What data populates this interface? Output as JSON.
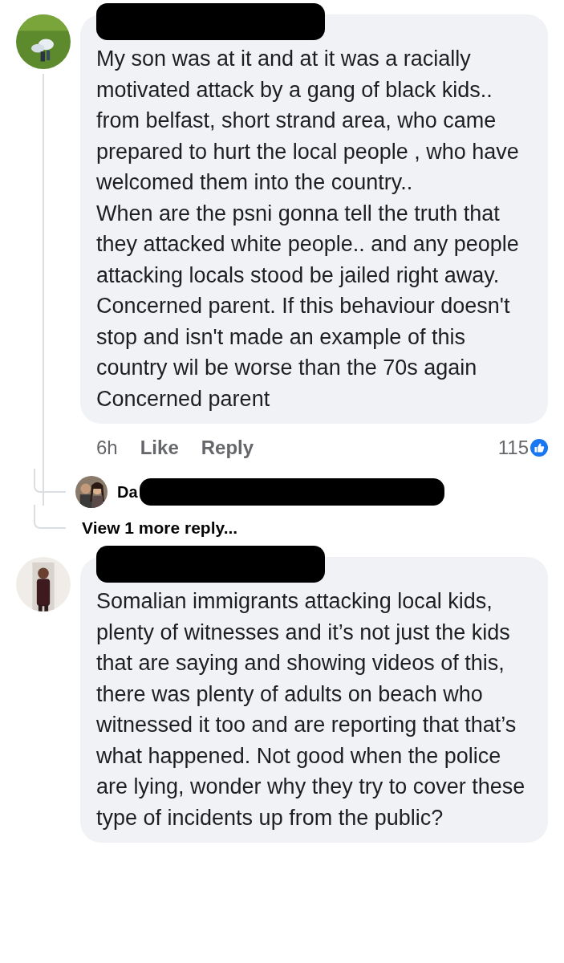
{
  "comments": [
    {
      "author": {
        "redacted": true
      },
      "avatar": {
        "kind": "picture"
      },
      "text": "My son was at it and at it was a racially motivated attack by a gang of  black kids.. from belfast, short strand area, who came prepared to hurt the local people ,  who have welcomed them into the country..\nWhen  are the psni gonna tell the truth that they attacked white people.. and any people attacking locals stood be jailed right away. Concerned parent. If this  behaviour doesn't stop and  isn't made an example of  this country wil be worse than the 70s again\nConcerned parent",
      "footer": {
        "time": "6h",
        "like": "Like",
        "reply": "Reply",
        "reactions": "115"
      },
      "replies": [
        {
          "author": {
            "name": "Da",
            "redacted": true
          },
          "avatar": {
            "kind": "picture"
          }
        }
      ],
      "more_replies": "View 1 more reply..."
    },
    {
      "author": {
        "redacted": true
      },
      "avatar": {
        "kind": "picture"
      },
      "text": "Somalian immigrants attacking local kids, plenty of witnesses and it’s not just the kids that are saying and showing videos of this, there was plenty of adults on beach who witnessed it too and are reporting that that’s what happened. Not good when the police are lying, wonder why they try to cover these type of incidents up from the public?"
    }
  ]
}
